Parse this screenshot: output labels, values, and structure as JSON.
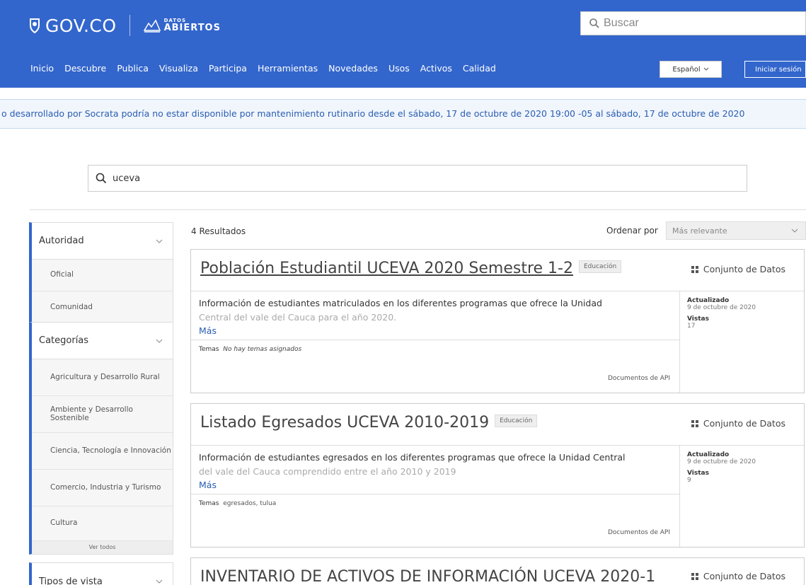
{
  "header": {
    "gov_text": "GOV.CO",
    "datos_small": "DATOS",
    "datos_big": "ABIERTOS",
    "search_placeholder": "Buscar",
    "nav": [
      "Inicio",
      "Descubre",
      "Publica",
      "Visualiza",
      "Participa",
      "Herramientas",
      "Novedades",
      "Usos",
      "Activos",
      "Calidad"
    ],
    "language": "Español",
    "login": "Iniciar sesión"
  },
  "banner": {
    "text": "o desarrollado por Socrata podría no estar disponible por mantenimiento rutinario desde el  sábado, 17 de octubre de 2020 19:00 -05  al  sábado, 17 de octubre de 2020"
  },
  "search": {
    "value": "uceva"
  },
  "sidebar": {
    "autoridad": {
      "title": "Autoridad",
      "items": [
        "Oficial",
        "Comunidad"
      ]
    },
    "categorias": {
      "title": "Categorías",
      "items": [
        "Agricultura y Desarrollo Rural",
        "Ambiente y Desarrollo Sostenible",
        "Ciencia, Tecnología e Innovación",
        "Comercio, Industria y Turismo",
        "Cultura"
      ],
      "more": "Ver todos"
    },
    "tipos": {
      "title": "Tipos de vista"
    }
  },
  "results": {
    "count": "4 Resultados",
    "sort_label": "Ordenar por",
    "sort_value": "Más relevante",
    "cards": [
      {
        "title": "Población Estudiantil UCEVA 2020 Semestre 1-2",
        "tag": "Educación",
        "type": "Conjunto de Datos",
        "desc_line1": "Información de estudiantes matriculados en los diferentes programas que ofrece la Unidad",
        "desc_line2": "Central del vale del Cauca para el año 2020.",
        "more": "Más",
        "temas_label": "Temas",
        "temas_value": "No hay temas asignados",
        "api": "Documentos de API",
        "updated_label": "Actualizado",
        "updated_value": "9 de octubre de 2020",
        "views_label": "Vistas",
        "views_value": "17"
      },
      {
        "title": "Listado Egresados UCEVA 2010-2019",
        "tag": "Educación",
        "type": "Conjunto de Datos",
        "desc_line1": "Información de estudiantes egresados en los diferentes programas que ofrece la Unidad Central",
        "desc_line2": "del vale del Cauca comprendido entre el año 2010 y 2019",
        "more": "Más",
        "temas_label": "Temas",
        "temas_value": "egresados, tulua",
        "api": "Documentos de API",
        "updated_label": "Actualizado",
        "updated_value": "9 de octubre de 2020",
        "views_label": "Vistas",
        "views_value": "9"
      },
      {
        "title": "INVENTARIO DE ACTIVOS DE INFORMACIÓN UCEVA 2020-1",
        "type": "Conjunto de Datos"
      }
    ]
  },
  "colors": {
    "brand": "#3366cc",
    "link": "#2a5db0"
  }
}
